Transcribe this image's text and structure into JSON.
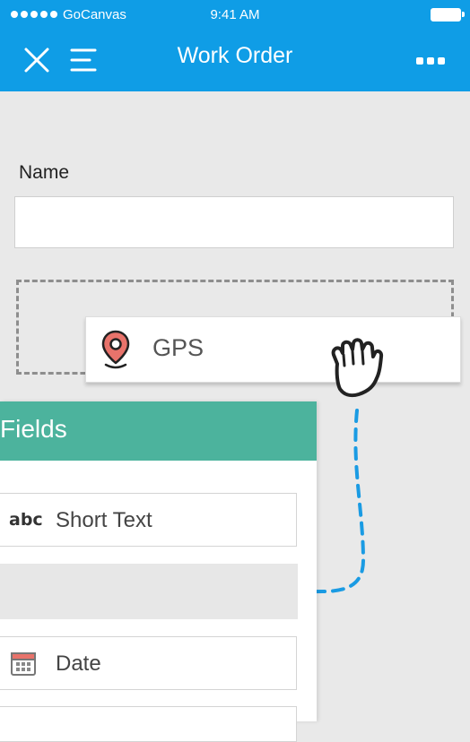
{
  "status_bar": {
    "carrier": "GoCanvas",
    "time": "9:41 AM"
  },
  "nav": {
    "title": "Work Order"
  },
  "form": {
    "name_label": "Name",
    "name_value": "",
    "dragged_field_label": "GPS"
  },
  "fields_panel": {
    "title": "Fields",
    "items": [
      {
        "icon": "abc-icon",
        "icon_text": "abc",
        "label": "Short Text"
      },
      {
        "icon": "calendar-icon",
        "label": "Date"
      }
    ]
  },
  "colors": {
    "header_blue": "#0f9de6",
    "fields_green": "#4cb39d",
    "drag_path_blue": "#1a9be3",
    "gps_pin_red": "#e8736b"
  }
}
